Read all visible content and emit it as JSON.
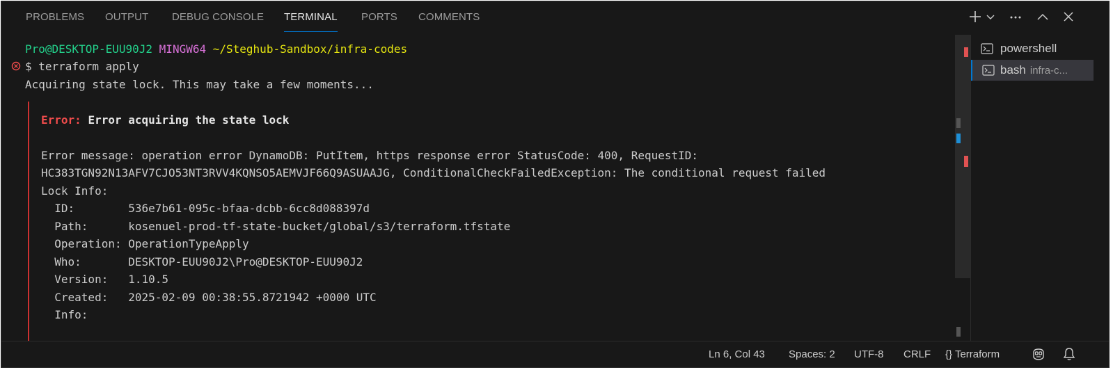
{
  "tabs": [
    {
      "label": "PROBLEMS",
      "active": false
    },
    {
      "label": "OUTPUT",
      "active": false
    },
    {
      "label": "DEBUG CONSOLE",
      "active": false
    },
    {
      "label": "TERMINAL",
      "active": true
    },
    {
      "label": "PORTS",
      "active": false
    },
    {
      "label": "COMMENTS",
      "active": false
    }
  ],
  "toolbar_icons": [
    "plus-icon",
    "chevron-down-icon",
    "ellipsis-icon",
    "chevron-up-icon",
    "close-icon"
  ],
  "terminal": {
    "prompt_user": "Pro@DESKTOP-EUU90J2",
    "prompt_env": "MINGW64",
    "prompt_path": "~/Steghub-Sandbox/infra-codes",
    "command": "$ terraform apply",
    "acquiring": "Acquiring state lock. This may take a few moments...",
    "error_label": "Error:",
    "error_title": "Error acquiring the state lock",
    "error_message_1": "Error message: operation error DynamoDB: PutItem, https response error StatusCode: 400, RequestID:",
    "error_message_2": "HC383TGN92N13AFV7CJO53NT3RVV4KQNSO5AEMVJF66Q9ASUAAJG, ConditionalCheckFailedException: The conditional request failed",
    "lock_info_label": "Lock Info:",
    "lock_info": [
      {
        "key": "  ID:        ",
        "value": "536e7b61-095c-bfaa-dcbb-6cc8d088397d"
      },
      {
        "key": "  Path:      ",
        "value": "kosenuel-prod-tf-state-bucket/global/s3/terraform.tfstate"
      },
      {
        "key": "  Operation: ",
        "value": "OperationTypeApply"
      },
      {
        "key": "  Who:       ",
        "value": "DESKTOP-EUU90J2\\Pro@DESKTOP-EUU90J2"
      },
      {
        "key": "  Version:   ",
        "value": "1.10.5"
      },
      {
        "key": "  Created:   ",
        "value": "2025-02-09 00:38:55.8721942 +0000 UTC"
      },
      {
        "key": "  Info:",
        "value": ""
      }
    ]
  },
  "terminal_list": [
    {
      "label": "powershell",
      "desc": "",
      "active": false
    },
    {
      "label": "bash",
      "desc": "infra-c...",
      "active": true
    }
  ],
  "status": {
    "position": "Ln 6, Col 43",
    "spaces": "Spaces: 2",
    "encoding": "UTF-8",
    "eol": "CRLF",
    "language_icon": "{}",
    "language": "Terraform"
  },
  "colors": {
    "prompt_user": "#23d18b",
    "prompt_env": "#d670d6",
    "prompt_path": "#e5e510",
    "error": "#f14c4c",
    "accent": "#0078d4"
  }
}
